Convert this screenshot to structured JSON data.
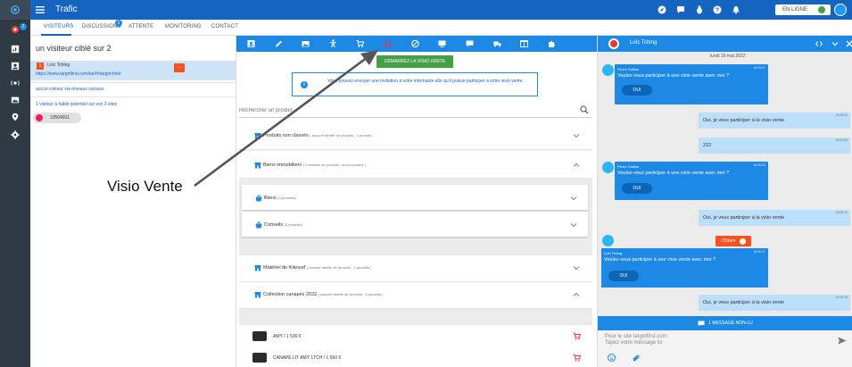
{
  "app": {
    "title": "Trafic",
    "rail_badge": "2",
    "accent": "#1565c0",
    "toolbar_color": "#1e88e5",
    "start_color": "#43a047",
    "alert_color": "#f4511e"
  },
  "topbar": {
    "status_label": "EN LIGNE",
    "icons": [
      "compass-icon",
      "chat-icon",
      "bug-icon",
      "help-icon",
      "bell-icon"
    ]
  },
  "tabs": [
    {
      "label": "VISITEURS"
    },
    {
      "label": "DISCUSSIONS",
      "badge": "1"
    },
    {
      "label": "ATTENTE"
    },
    {
      "label": "MONITORING"
    },
    {
      "label": "CONTACT"
    }
  ],
  "left": {
    "title": "un visiteur ciblé sur 2",
    "visitor": {
      "number": "1",
      "name": "Loïc Tching",
      "url": "https://www.targetfirst.com/tar/fr/target-first/"
    },
    "no_social": "aucun visiteur via réseaux sociaux",
    "potential": "1 visiteur à faible potentiel sur vos 3 sites",
    "chip_id": "10504911"
  },
  "center": {
    "start_button": "DÉMARREZ LA VISIO VENTE",
    "info": "Vous pouvez envoyer une invitation à votre internaute afin qu'il puisse participer à votre visio vente.",
    "search_placeholder": "Rechercher un produit",
    "panels": [
      {
        "name": "Produits non classés",
        "meta": "( aucune famille de produits ; 1 produit)"
      },
      {
        "name": "Biens immobiliers",
        "meta": "( 2 familles de produits ; aucun produit )"
      },
      {
        "name": "Matériel de Kitesurf",
        "meta": "( aucune famille de produits ; 2 produits )"
      },
      {
        "name": "Collection canapés 2022",
        "meta": "( aucune famille de produits ; 3 produits )"
      }
    ],
    "subs": [
      {
        "name": "Biens",
        "meta": "(3 produits)"
      },
      {
        "name": "Conseils",
        "meta": "(3 produits)"
      }
    ],
    "products": [
      {
        "name": "AMY / 1 530 €"
      },
      {
        "name": "CANAPÉ LIT AMY 1TCH / 1 650 €"
      }
    ]
  },
  "chat": {
    "contact": "Loïc Tching",
    "date": "lundi 16 mai 2022",
    "msg1": {
      "sender": "Pierre Guillou",
      "time": "16:05:37",
      "text": "Voulez-vous participer à une visio vente avec moi ?",
      "button": "OUI"
    },
    "out1": {
      "time": "16:05:52",
      "text": "Oui, je veux participer à la visio vente"
    },
    "out2": {
      "time": "16:05:55",
      "text": "222"
    },
    "msg2": {
      "sender": "Pierre Guillou",
      "time": "16:06:06",
      "text": "Voulez-vous participer à une visio vente avec moi ?",
      "button": "OUI"
    },
    "out3": {
      "time": "16:06:11",
      "text": "Oui, je veux participer à la visio vente"
    },
    "cloture": "Clôture",
    "msg3": {
      "sender": "Loïc Tching",
      "time": "16:06:27",
      "text": "Voulez-vous participer à une visio vente avec moi ?",
      "button": "OUI"
    },
    "out4": {
      "time": "16:06:35",
      "text": "Oui, je veux participer à la visio vente"
    },
    "unread": "1 MESSAGE NON-LU",
    "composer_line1": "Pour le site targetfirst.com",
    "composer_line2": "Tapez votre message ici"
  },
  "annotation": {
    "label": "Visio Vente"
  }
}
